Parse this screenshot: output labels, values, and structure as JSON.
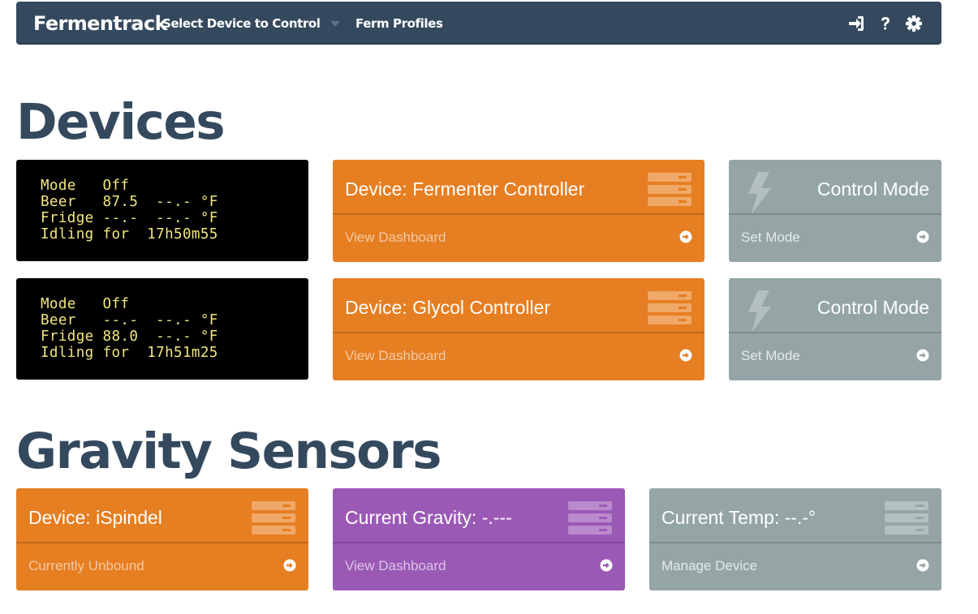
{
  "navbar": {
    "brand": "Fermentrack",
    "select_device": "Select Device to Control",
    "ferm_profiles": "Ferm Profiles",
    "icons": [
      "sign-in-icon",
      "question-icon",
      "gear-icon"
    ]
  },
  "devices_section": {
    "title": "Devices",
    "rows": [
      {
        "lcd": [
          "Mode   Off",
          "Beer   87.5  --.- °F",
          "Fridge --.-  --.- °F",
          "Idling for  17h50m55"
        ],
        "device_panel": {
          "title": "Device: Fermenter Controller",
          "link": "View Dashboard"
        },
        "mode_panel": {
          "title": "Control Mode",
          "link": "Set Mode"
        }
      },
      {
        "lcd": [
          "Mode   Off",
          "Beer   --.-  --.- °F",
          "Fridge 88.0  --.- °F",
          "Idling for  17h51m25"
        ],
        "device_panel": {
          "title": "Device: Glycol Controller",
          "link": "View Dashboard"
        },
        "mode_panel": {
          "title": "Control Mode",
          "link": "Set Mode"
        }
      }
    ]
  },
  "gravity_section": {
    "title": "Gravity Sensors",
    "panels": [
      {
        "title": "Device: iSpindel",
        "link": "Currently Unbound"
      },
      {
        "title": "Current Gravity: -.---",
        "link": "View Dashboard"
      },
      {
        "title": "Current Temp: --.-°",
        "link": "Manage Device"
      }
    ]
  },
  "colors": {
    "navbar": "#34495e",
    "heading": "#34495e",
    "orange": "#e67e22",
    "grey": "#95a5a6",
    "purple": "#9b59b6",
    "lcd_text": "#f1e67e"
  }
}
